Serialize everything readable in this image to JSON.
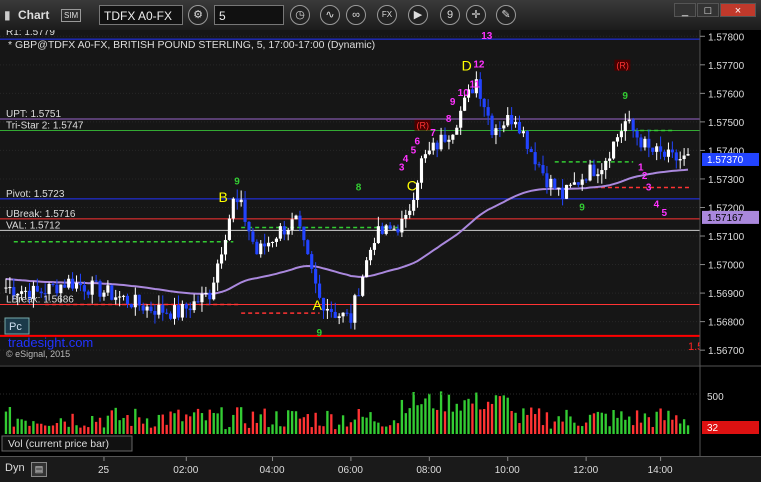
{
  "window": {
    "title": "Chart",
    "badge": "SIM",
    "symbol": "TDFX A0-FX",
    "interval": "5",
    "buttons": [
      "gear-icon",
      "clock-icon",
      "draw-icon",
      "fx-icon",
      "play-icon",
      "nine-icon",
      "cursor-icon",
      "tools-icon"
    ],
    "win_controls": [
      "_",
      "□",
      "×"
    ]
  },
  "header": {
    "first_level": "R1: 1.5779",
    "description": "* GBP@TDFX A0-FX, BRITISH POUND STERLING, 5, 17:00-17:00 (Dynamic)"
  },
  "level_labels": [
    {
      "text": "UPT: 1.5751",
      "value": 1.5751,
      "color": "#9966cc"
    },
    {
      "text": "Tri-Star 2: 1.5747",
      "value": 1.5747,
      "color": "#33aa33"
    },
    {
      "text": "Pivot: 1.5723",
      "value": 1.5723,
      "color": "#2233ff"
    },
    {
      "text": "UBreak: 1.5716",
      "value": 1.5716,
      "color": "#ff3333"
    },
    {
      "text": "VAL: 1.5712",
      "value": 1.5712,
      "color": "#cccccc"
    },
    {
      "text": "LBreak: 1.5686",
      "value": 1.5686,
      "color": "#ff3333"
    }
  ],
  "watermark": "tradesight.com",
  "copyright": "© eSignal, 2015",
  "pc_button": "Pc",
  "right_marker": "1.5",
  "volume_label": "Vol (current price bar)",
  "dyn_label": "Dyn",
  "chart_data": {
    "type": "candlestick",
    "y_axis": {
      "ticks": [
        1.578,
        1.577,
        1.576,
        1.575,
        1.574,
        1.573,
        1.572,
        1.571,
        1.57,
        1.569,
        1.568,
        1.567
      ],
      "tick_labels": [
        "1.57800",
        "1.57700",
        "1.57600",
        "1.57500",
        "1.57400",
        "1.57300",
        "1.57200",
        "1.57100",
        "1.57000",
        "1.56900",
        "1.56800",
        "1.56700"
      ],
      "range": [
        1.56655,
        1.57815
      ]
    },
    "current_price": {
      "label": "1.57370",
      "value": 1.5737
    },
    "va_price": {
      "label": "1.57167",
      "value": 1.57167
    },
    "x_axis": {
      "tick_labels": [
        "25",
        "02:00",
        "04:00",
        "06:00",
        "08:00",
        "10:00",
        "12:00",
        "14:00"
      ],
      "tick_bars": [
        25,
        46,
        68,
        88,
        108,
        128,
        148,
        167
      ]
    },
    "bar_count": 175,
    "anchors": [
      [
        0,
        1.5692
      ],
      [
        8,
        1.569
      ],
      [
        16,
        1.5694
      ],
      [
        24,
        1.5691
      ],
      [
        30,
        1.5688
      ],
      [
        36,
        1.5685
      ],
      [
        44,
        1.5683
      ],
      [
        52,
        1.569
      ],
      [
        58,
        1.5722
      ],
      [
        60,
        1.572
      ],
      [
        64,
        1.5704
      ],
      [
        70,
        1.5712
      ],
      [
        74,
        1.5715
      ],
      [
        80,
        1.5688
      ],
      [
        84,
        1.5683
      ],
      [
        88,
        1.5681
      ],
      [
        90,
        1.5692
      ],
      [
        94,
        1.571
      ],
      [
        98,
        1.5712
      ],
      [
        102,
        1.5715
      ],
      [
        106,
        1.5736
      ],
      [
        114,
        1.5748
      ],
      [
        120,
        1.5765
      ],
      [
        124,
        1.5748
      ],
      [
        130,
        1.5752
      ],
      [
        134,
        1.574
      ],
      [
        138,
        1.573
      ],
      [
        142,
        1.5724
      ],
      [
        148,
        1.5732
      ],
      [
        152,
        1.5735
      ],
      [
        158,
        1.575
      ],
      [
        164,
        1.574
      ],
      [
        170,
        1.5737
      ],
      [
        174,
        1.5737
      ]
    ],
    "levels": [
      {
        "name": "R1",
        "value": 1.5779,
        "color": "#2233ff"
      },
      {
        "name": "UPT",
        "value": 1.5751,
        "color": "#9966cc"
      },
      {
        "name": "Tri-Star 2",
        "value": 1.5747,
        "color": "#33aa33"
      },
      {
        "name": "Pivot",
        "value": 1.5723,
        "color": "#2233ff"
      },
      {
        "name": "UBreak",
        "value": 1.5716,
        "color": "#ff3333"
      },
      {
        "name": "VAL",
        "value": 1.5712,
        "color": "#cccccc"
      },
      {
        "name": "LBreak",
        "value": 1.5686,
        "color": "#ff3333"
      },
      {
        "name": "S1",
        "value": 1.5675,
        "color": "#ff0000"
      }
    ],
    "annotations": [
      {
        "text": "A",
        "bar": 79,
        "value": 1.5684,
        "color": "#ffff00"
      },
      {
        "text": "B",
        "bar": 55,
        "value": 1.5722,
        "color": "#ffff00"
      },
      {
        "text": "C",
        "bar": 103,
        "value": 1.5726,
        "color": "#ffff00"
      },
      {
        "text": "D",
        "bar": 117,
        "value": 1.5768,
        "color": "#ffff00"
      },
      {
        "text": "13",
        "bar": 122,
        "value": 1.5779,
        "color": "#ff33ff"
      },
      {
        "text": "12",
        "bar": 120,
        "value": 1.5769,
        "color": "#ff33ff"
      },
      {
        "text": "11",
        "bar": 119,
        "value": 1.5762,
        "color": "#ff33ff"
      },
      {
        "text": "10",
        "bar": 116,
        "value": 1.5759,
        "color": "#ff33ff"
      },
      {
        "text": "9",
        "bar": 114,
        "value": 1.5756,
        "color": "#ff33ff"
      },
      {
        "text": "8",
        "bar": 113,
        "value": 1.575,
        "color": "#ff33ff"
      },
      {
        "text": "7",
        "bar": 109,
        "value": 1.5745,
        "color": "#ff33ff"
      },
      {
        "text": "6",
        "bar": 105,
        "value": 1.5742,
        "color": "#ff33ff"
      },
      {
        "text": "5",
        "bar": 104,
        "value": 1.5739,
        "color": "#ff33ff"
      },
      {
        "text": "4",
        "bar": 102,
        "value": 1.5736,
        "color": "#ff33ff"
      },
      {
        "text": "3",
        "bar": 101,
        "value": 1.5733,
        "color": "#ff33ff"
      },
      {
        "text": "R",
        "bar": 106,
        "value": 1.5748,
        "color": "#ff3333"
      },
      {
        "text": "R",
        "bar": 157,
        "value": 1.5769,
        "color": "#ff3333"
      },
      {
        "text": "8",
        "bar": 90,
        "value": 1.5726,
        "color": "#33cc33"
      },
      {
        "text": "9",
        "bar": 59,
        "value": 1.5728,
        "color": "#33cc33"
      },
      {
        "text": "9",
        "bar": 80,
        "value": 1.5675,
        "color": "#33cc33"
      },
      {
        "text": "9",
        "bar": 147,
        "value": 1.5719,
        "color": "#33cc33"
      },
      {
        "text": "9",
        "bar": 158,
        "value": 1.5758,
        "color": "#33cc33"
      },
      {
        "text": "1",
        "bar": 162,
        "value": 1.5733,
        "color": "#ff33ff"
      },
      {
        "text": "2",
        "bar": 163,
        "value": 1.573,
        "color": "#ff33ff"
      },
      {
        "text": "3",
        "bar": 164,
        "value": 1.5726,
        "color": "#ff33ff"
      },
      {
        "text": "4",
        "bar": 166,
        "value": 1.572,
        "color": "#ff33ff"
      },
      {
        "text": "5",
        "bar": 168,
        "value": 1.5717,
        "color": "#ff33ff"
      }
    ],
    "volume": {
      "label": "Vol (current price bar)",
      "tick": 500,
      "current": 32,
      "current_label": "32",
      "ylim": [
        0,
        800
      ]
    },
    "colors": {
      "up": "#ffffff",
      "down": "#2244ff",
      "ma": "#aa88dd",
      "vol_up": "#33cc33",
      "vol_down": "#ff3333"
    }
  }
}
